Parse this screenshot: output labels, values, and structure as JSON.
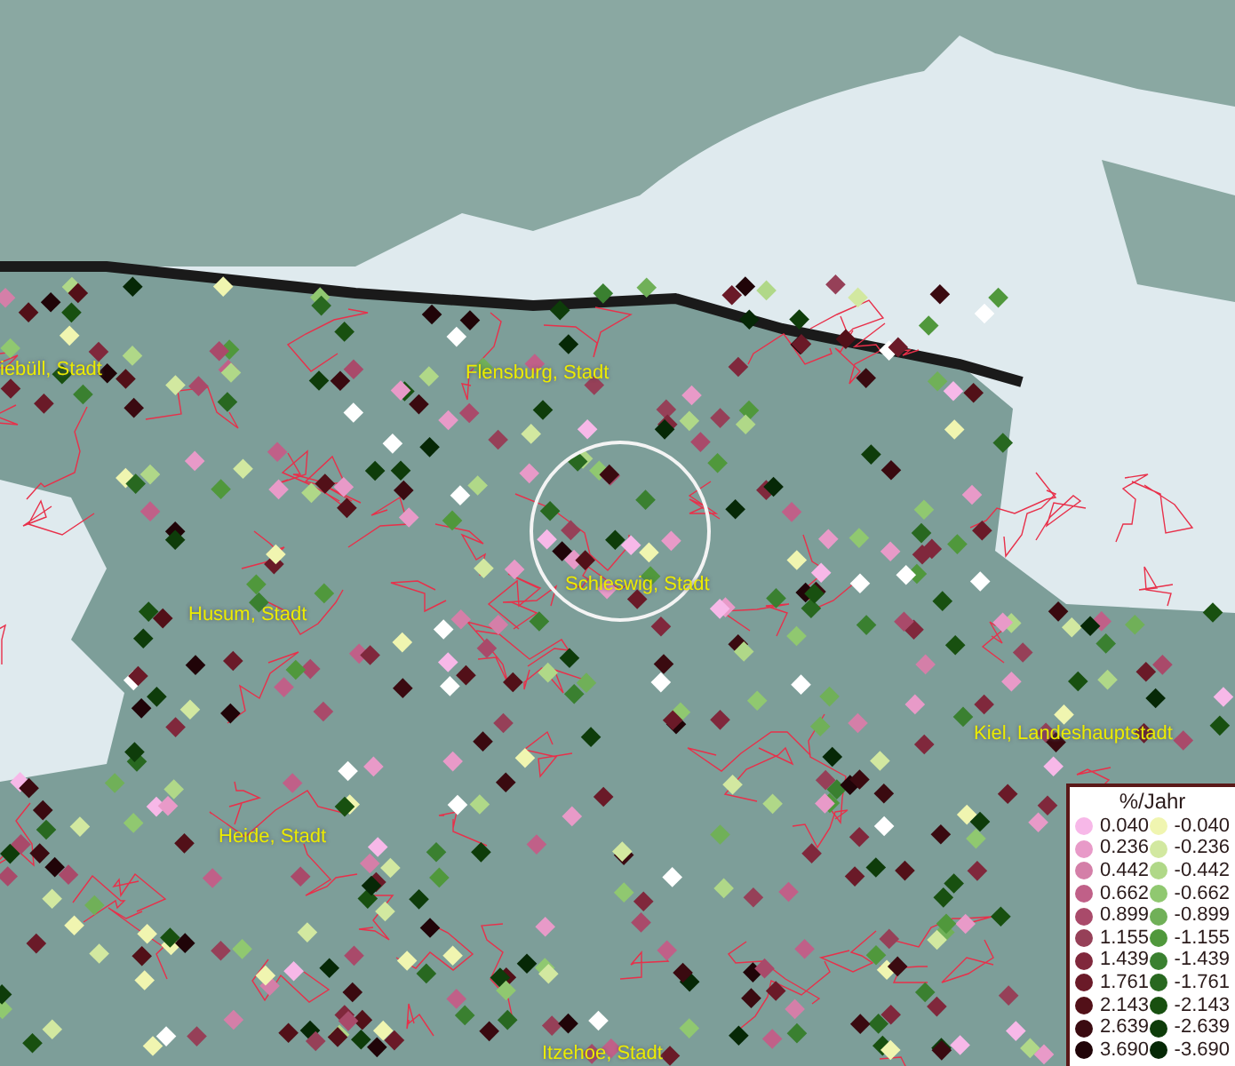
{
  "map": {
    "places": [
      {
        "label": "iebüll, Stadt"
      },
      {
        "label": "Flensburg, Stadt"
      },
      {
        "label": "Schleswig, Stadt"
      },
      {
        "label": "Husum, Stadt"
      },
      {
        "label": "Kiel, Landeshauptstadt"
      },
      {
        "label": "Heide, Stadt"
      },
      {
        "label": "Itzehoe, Stadt"
      }
    ]
  },
  "legend": {
    "title": "%/Jahr",
    "rows": [
      {
        "positive": {
          "label": "0.040",
          "color": "#f7b8e8"
        },
        "negative": {
          "label": "-0.040",
          "color": "#f0f5b0"
        }
      },
      {
        "positive": {
          "label": "0.236",
          "color": "#e89ac8"
        },
        "negative": {
          "label": "-0.236",
          "color": "#d2e8a0"
        }
      },
      {
        "positive": {
          "label": "0.442",
          "color": "#d47fa8"
        },
        "negative": {
          "label": "-0.442",
          "color": "#b0d888"
        }
      },
      {
        "positive": {
          "label": "0.662",
          "color": "#c06088"
        },
        "negative": {
          "label": "-0.662",
          "color": "#90c870"
        }
      },
      {
        "positive": {
          "label": "0.899",
          "color": "#a94a6a"
        },
        "negative": {
          "label": "-0.899",
          "color": "#70b058"
        }
      },
      {
        "positive": {
          "label": "1.155",
          "color": "#964058"
        },
        "negative": {
          "label": "-1.155",
          "color": "#50983c"
        }
      },
      {
        "positive": {
          "label": "1.439",
          "color": "#80283c"
        },
        "negative": {
          "label": "-1.439",
          "color": "#3a8030"
        }
      },
      {
        "positive": {
          "label": "1.761",
          "color": "#6a1a28"
        },
        "negative": {
          "label": "-1.761",
          "color": "#286820"
        }
      },
      {
        "positive": {
          "label": "2.143",
          "color": "#521018"
        },
        "negative": {
          "label": "-2.143",
          "color": "#185010"
        }
      },
      {
        "positive": {
          "label": "2.639",
          "color": "#3a0a10"
        },
        "negative": {
          "label": "-2.639",
          "color": "#0e3c0a"
        }
      },
      {
        "positive": {
          "label": "3.690",
          "color": "#200408"
        },
        "negative": {
          "label": "-3.690",
          "color": "#062806"
        }
      }
    ]
  }
}
